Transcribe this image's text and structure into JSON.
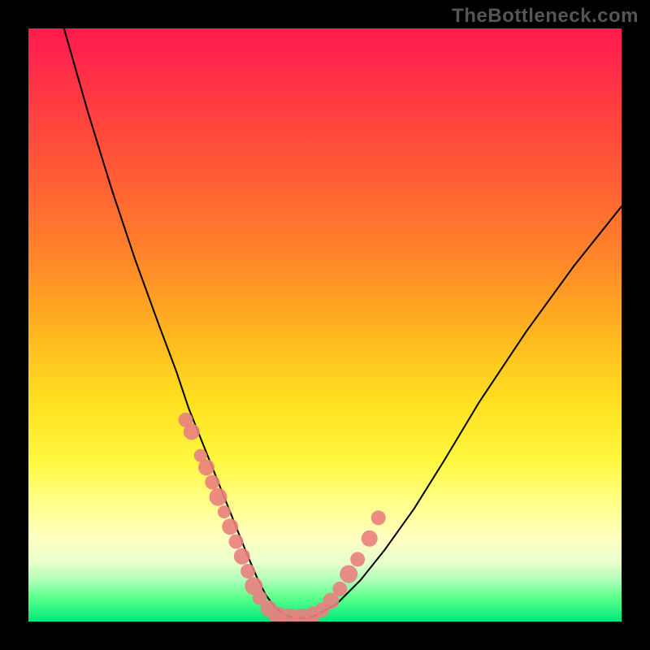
{
  "watermark": "TheBottleneck.com",
  "colors": {
    "dot": "#e98080",
    "curve": "#000000",
    "gradient_top": "#ff1a4d",
    "gradient_bottom": "#00e87a"
  },
  "chart_data": {
    "type": "line",
    "title": "",
    "xlabel": "",
    "ylabel": "",
    "xlim": [
      0,
      100
    ],
    "ylim": [
      0,
      100
    ],
    "curve": {
      "x": [
        6,
        10,
        14,
        18,
        22,
        25,
        27,
        29,
        31,
        33,
        35,
        37,
        38.5,
        40,
        41.5,
        43,
        45,
        48,
        52,
        56,
        60,
        65,
        70,
        76,
        84,
        92,
        100
      ],
      "y": [
        100,
        86,
        73,
        61,
        50,
        42,
        36,
        31,
        26,
        21,
        16,
        11,
        7.5,
        4.5,
        2.5,
        1.2,
        0.5,
        0.8,
        3,
        7,
        12,
        19,
        27,
        37,
        49,
        60,
        70
      ]
    },
    "points": {
      "x": [
        26.5,
        27.5,
        29,
        30,
        31,
        32,
        33,
        34,
        35,
        36,
        37,
        38,
        39,
        40.5,
        42,
        44,
        46,
        48,
        49.5,
        51,
        52.5,
        54,
        55.5,
        57.5,
        59
      ],
      "y": [
        34,
        32,
        28,
        26,
        23.5,
        21,
        18.5,
        16,
        13.5,
        11,
        8.5,
        6,
        4,
        2.2,
        1,
        0.6,
        0.7,
        1.2,
        2,
        3.5,
        5.5,
        8,
        10.5,
        14,
        17.5
      ],
      "r": [
        9,
        10,
        8,
        10,
        9,
        11,
        8,
        10,
        9,
        10,
        9,
        11,
        9,
        10,
        11,
        12,
        11,
        10,
        9,
        10,
        9,
        11,
        9,
        10,
        9
      ]
    }
  }
}
